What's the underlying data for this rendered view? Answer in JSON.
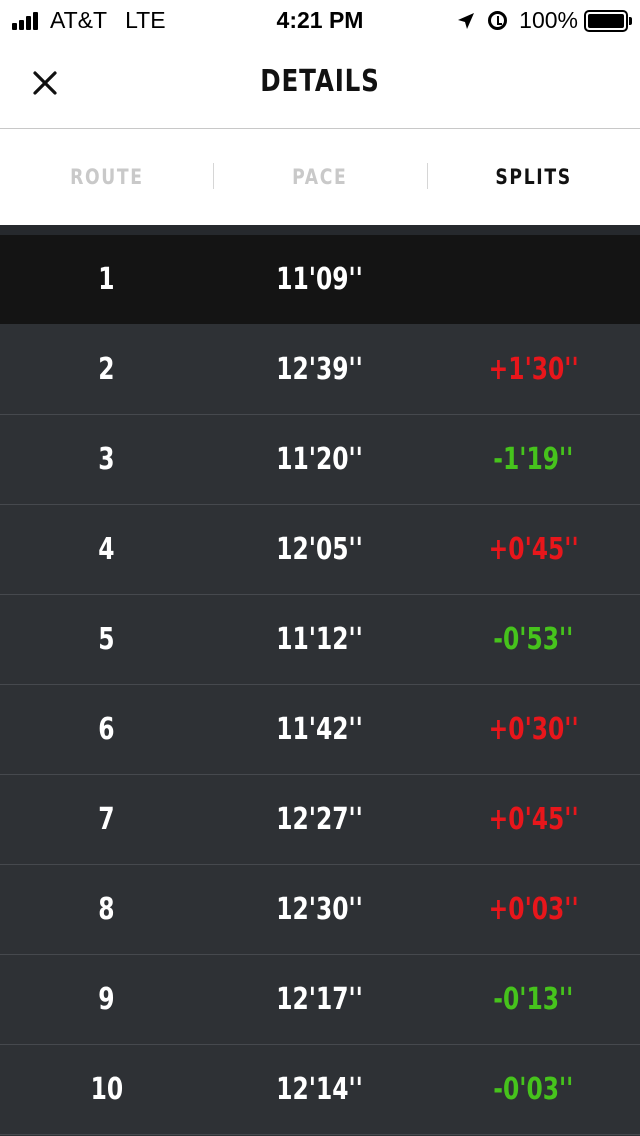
{
  "status_bar": {
    "carrier": "AT&T",
    "network": "LTE",
    "time": "4:21 PM",
    "battery": "100%",
    "icons": [
      "signal-icon",
      "location-arrow-icon",
      "alarm-icon",
      "battery-icon"
    ]
  },
  "navbar": {
    "title": "DETAILS",
    "close_icon": "close-icon"
  },
  "tabs": [
    {
      "label": "ROUTE",
      "active": false
    },
    {
      "label": "PACE",
      "active": false
    },
    {
      "label": "SPLITS",
      "active": true
    }
  ],
  "colors": {
    "positive_diff": "#e8161b",
    "negative_diff": "#46c31c",
    "row_background": "#2e3135",
    "first_row_background": "#141414"
  },
  "splits": [
    {
      "mile": "1",
      "pace": "11'09''",
      "diff": ""
    },
    {
      "mile": "2",
      "pace": "12'39''",
      "diff": "+1'30''"
    },
    {
      "mile": "3",
      "pace": "11'20''",
      "diff": "-1'19''"
    },
    {
      "mile": "4",
      "pace": "12'05''",
      "diff": "+0'45''"
    },
    {
      "mile": "5",
      "pace": "11'12''",
      "diff": "-0'53''"
    },
    {
      "mile": "6",
      "pace": "11'42''",
      "diff": "+0'30''"
    },
    {
      "mile": "7",
      "pace": "12'27''",
      "diff": "+0'45''"
    },
    {
      "mile": "8",
      "pace": "12'30''",
      "diff": "+0'03''"
    },
    {
      "mile": "9",
      "pace": "12'17''",
      "diff": "-0'13''"
    },
    {
      "mile": "10",
      "pace": "12'14''",
      "diff": "-0'03''"
    }
  ]
}
